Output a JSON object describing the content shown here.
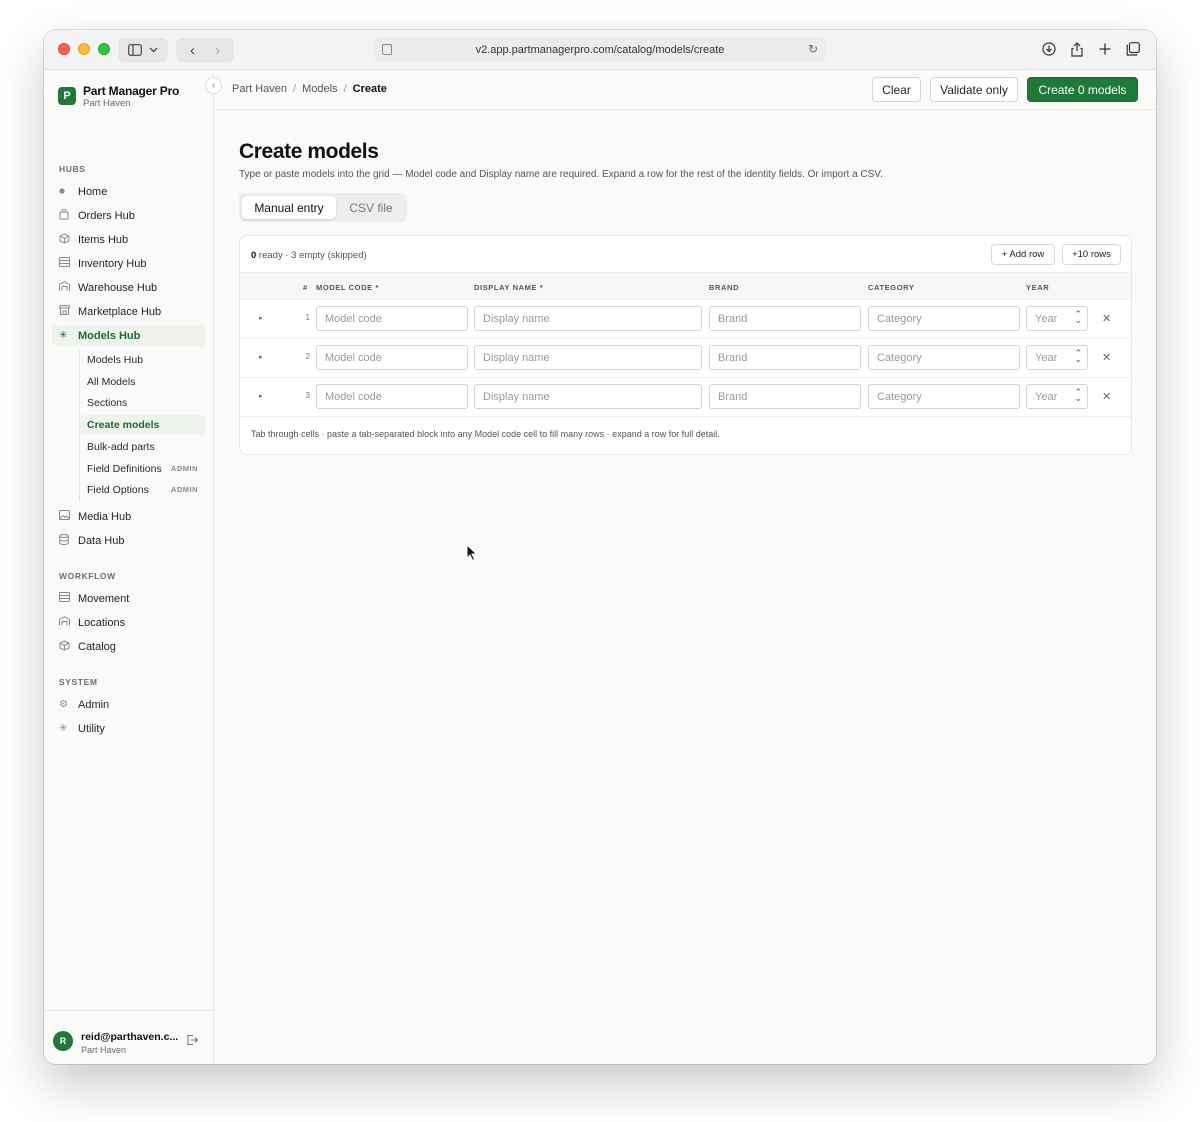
{
  "browser": {
    "url": "v2.app.partmanagerpro.com/catalog/models/create"
  },
  "brand": {
    "logo_letter": "P",
    "name": "Part Manager Pro",
    "org": "Part Haven"
  },
  "sidebar": {
    "hubs_label": "HUBS",
    "hubs": [
      {
        "label": "Home",
        "icon": "dot-icon"
      },
      {
        "label": "Orders Hub",
        "icon": "bag-icon"
      },
      {
        "label": "Items Hub",
        "icon": "box-icon"
      },
      {
        "label": "Inventory Hub",
        "icon": "list-icon"
      },
      {
        "label": "Warehouse Hub",
        "icon": "warehouse-icon"
      },
      {
        "label": "Marketplace Hub",
        "icon": "store-icon"
      },
      {
        "label": "Models Hub",
        "icon": "sparkle-icon"
      }
    ],
    "models_sub": [
      {
        "label": "Models Hub",
        "badge": ""
      },
      {
        "label": "All Models",
        "badge": ""
      },
      {
        "label": "Sections",
        "badge": ""
      },
      {
        "label": "Create models",
        "badge": ""
      },
      {
        "label": "Bulk-add parts",
        "badge": ""
      },
      {
        "label": "Field Definitions",
        "badge": "ADMIN"
      },
      {
        "label": "Field Options",
        "badge": "ADMIN"
      }
    ],
    "more_hubs": [
      {
        "label": "Media Hub",
        "icon": "image-icon"
      },
      {
        "label": "Data Hub",
        "icon": "database-icon"
      }
    ],
    "workflow_label": "WORKFLOW",
    "workflow": [
      {
        "label": "Movement",
        "icon": "list-icon"
      },
      {
        "label": "Locations",
        "icon": "warehouse-icon"
      },
      {
        "label": "Catalog",
        "icon": "box-icon"
      }
    ],
    "system_label": "SYSTEM",
    "system": [
      {
        "label": "Admin",
        "icon": "gear-icon"
      },
      {
        "label": "Utility",
        "icon": "sparkle-icon"
      }
    ]
  },
  "user": {
    "initial": "R",
    "email": "reid@parthaven.c...",
    "org": "Part Haven"
  },
  "breadcrumb": {
    "items": [
      "Part Haven",
      "Models",
      "Create"
    ],
    "separator": "/"
  },
  "actions": {
    "clear": "Clear",
    "validate": "Validate only",
    "create": "Create 0 models"
  },
  "page": {
    "title": "Create models",
    "description": "Type or paste models into the grid — Model code and Display name are required. Expand a row for the rest of the identity fields. Or import a CSV."
  },
  "tabs": {
    "manual": "Manual entry",
    "csv": "CSV file"
  },
  "grid": {
    "summary_count": "0",
    "summary_text": " ready · 3 empty (skipped)",
    "add_row": "+ Add row",
    "add_ten": "+10 rows",
    "columns": {
      "num": "#",
      "model_code": "MODEL CODE *",
      "display_name": "DISPLAY NAME *",
      "brand": "BRAND",
      "category": "CATEGORY",
      "year": "YEAR"
    },
    "placeholders": {
      "model_code": "Model code",
      "display_name": "Display name",
      "brand": "Brand",
      "category": "Category",
      "year": "Year"
    },
    "rows": [
      {
        "num": "1"
      },
      {
        "num": "2"
      },
      {
        "num": "3"
      }
    ],
    "hint": "Tab through cells · paste a tab-separated block into any Model code cell to fill many rows · expand a row for full detail."
  },
  "colors": {
    "accent": "#1f7a3a",
    "active_bg": "#eef3ec"
  }
}
